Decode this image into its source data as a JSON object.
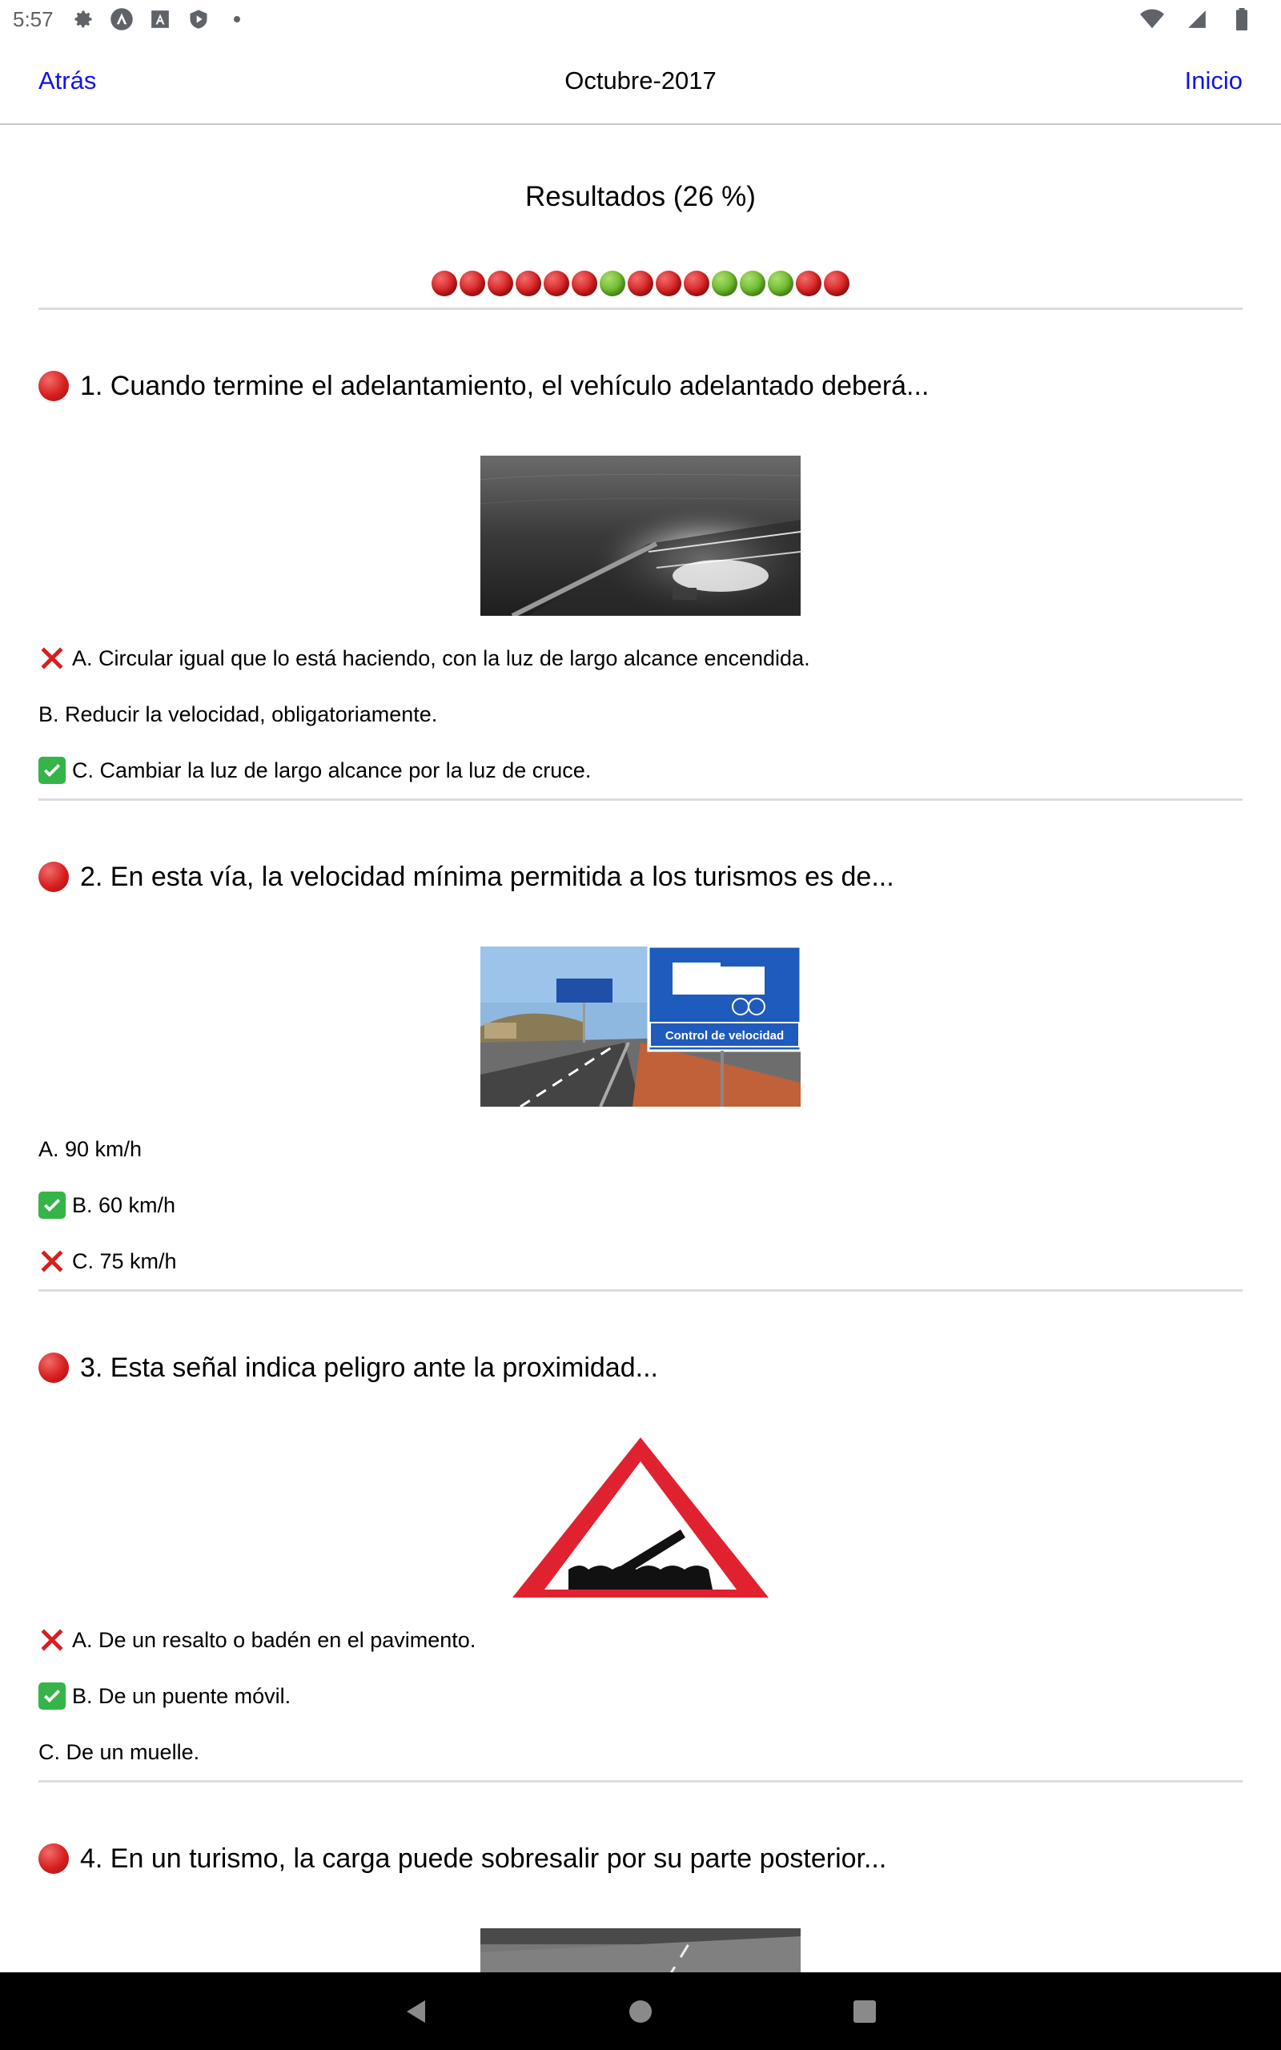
{
  "status_bar": {
    "time": "5:57",
    "icons": [
      "settings-icon",
      "a-icon",
      "font-icon",
      "shield-play-icon",
      "dot-icon"
    ],
    "right_icons": [
      "wifi-icon",
      "signal-icon",
      "battery-icon"
    ]
  },
  "navbar": {
    "back_label": "Atrás",
    "title": "Octubre-2017",
    "home_label": "Inicio"
  },
  "results": {
    "title": "Resultados (26 %)",
    "dots": [
      "red",
      "red",
      "red",
      "red",
      "red",
      "red",
      "green",
      "red",
      "red",
      "red",
      "green",
      "green",
      "green",
      "red",
      "red"
    ]
  },
  "questions": [
    {
      "title": "1. Cuando termine el adelantamiento, el vehículo adelantado deberá...",
      "image": "night-road-headlights-photo",
      "answers": [
        {
          "text": "A. Circular igual que lo está haciendo, con la luz de largo alcance encendida.",
          "mark": "wrong"
        },
        {
          "text": "B. Reducir la velocidad, obligatoriamente.",
          "mark": "none"
        },
        {
          "text": "C. Cambiar la luz de largo alcance por la luz de cruce.",
          "mark": "correct"
        }
      ]
    },
    {
      "title": "2. En esta vía, la velocidad mínima permitida a los turismos es de...",
      "image": "highway-speed-control-sign-photo",
      "sign_text": "Control de velocidad",
      "answers": [
        {
          "text": "A. 90 km/h",
          "mark": "none"
        },
        {
          "text": "B. 60 km/h",
          "mark": "correct"
        },
        {
          "text": "C. 75 km/h",
          "mark": "wrong"
        }
      ]
    },
    {
      "title": "3. Esta señal indica peligro ante la proximidad...",
      "image": "movable-bridge-warning-sign",
      "answers": [
        {
          "text": "A. De un resalto o badén en el pavimento.",
          "mark": "wrong"
        },
        {
          "text": "B. De un puente móvil.",
          "mark": "correct"
        },
        {
          "text": "C. De un muelle.",
          "mark": "none"
        }
      ]
    },
    {
      "title": "4. En un turismo, la carga puede sobresalir por su parte posterior...",
      "image": "car-with-load-road-photo",
      "answers": []
    }
  ],
  "system_nav": [
    "back-triangle-icon",
    "home-circle-icon",
    "recents-square-icon"
  ],
  "colors": {
    "link": "#1212e8",
    "wrong_red": "#d61f1f",
    "correct_green": "#35b44a",
    "separator": "#dcdcdc"
  }
}
